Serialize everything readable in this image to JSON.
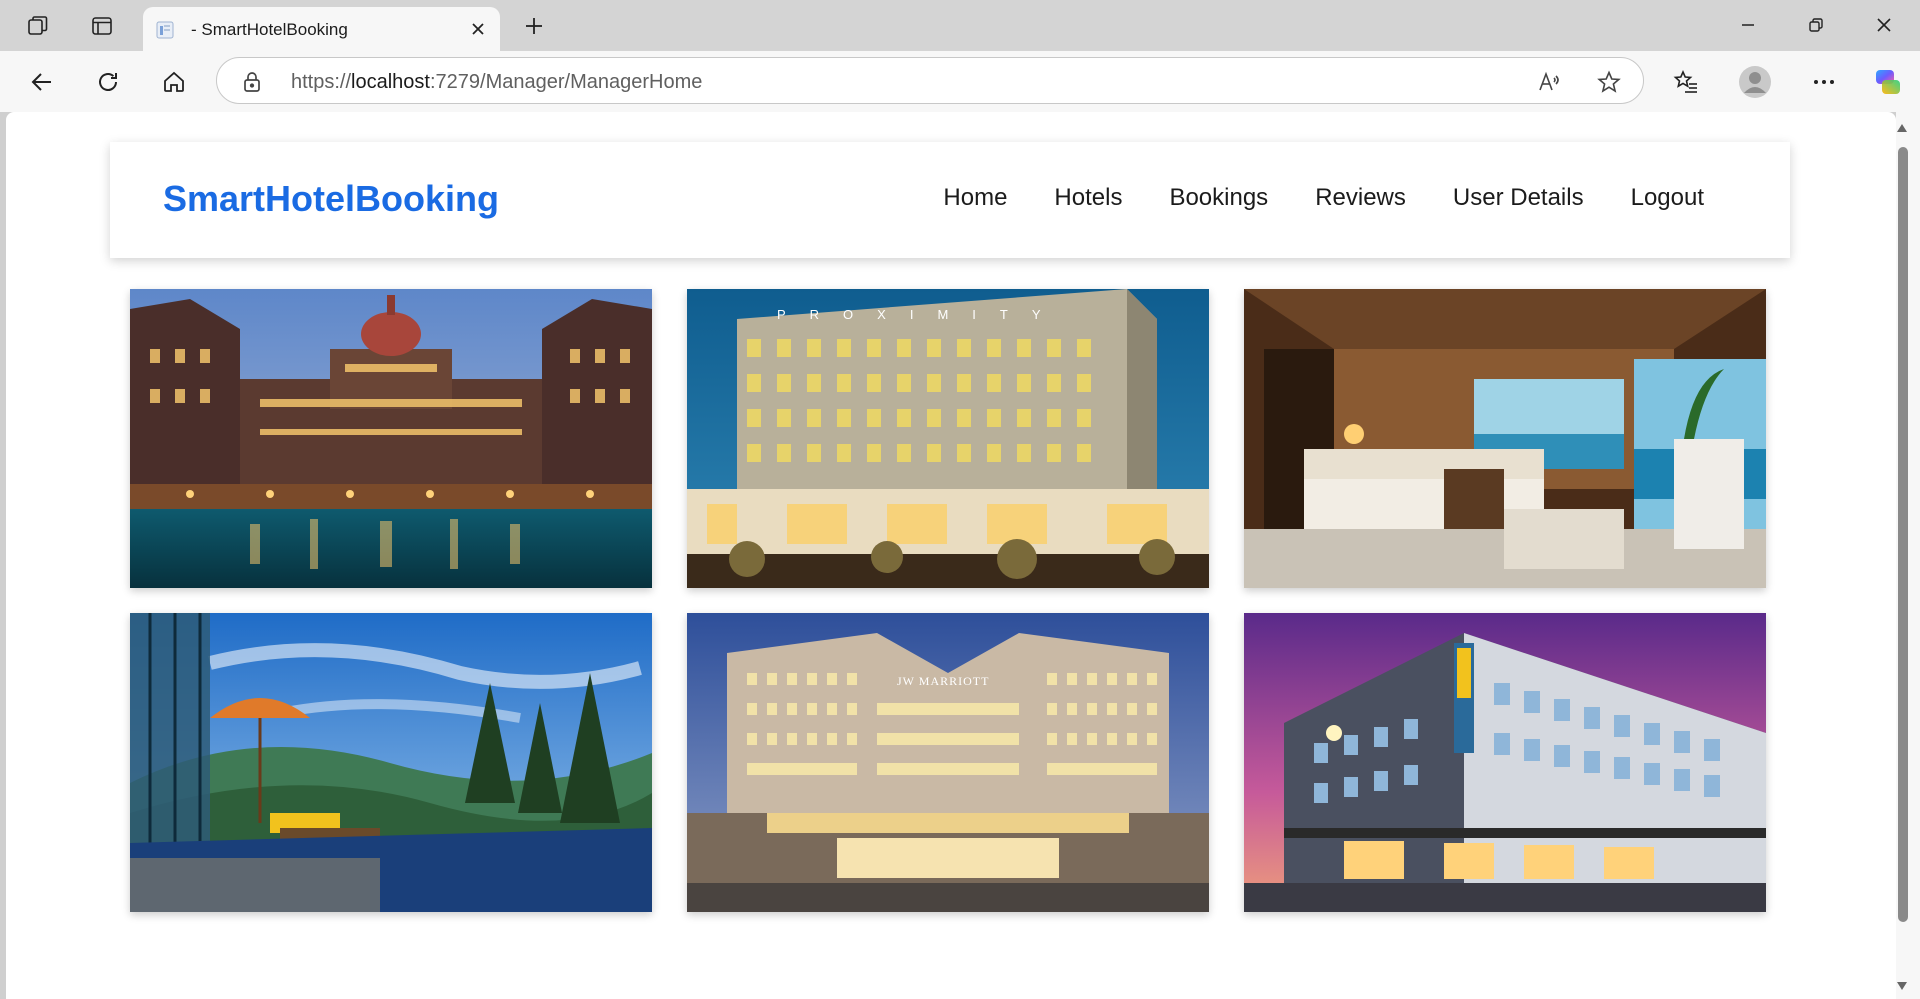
{
  "browser": {
    "tab_title": "- SmartHotelBooking",
    "url_scheme": "https://",
    "url_host": "localhost",
    "url_rest": ":7279/Manager/ManagerHome"
  },
  "site": {
    "brand": "SmartHotelBooking",
    "brand_color": "#1a6be3",
    "nav": [
      "Home",
      "Hotels",
      "Bookings",
      "Reviews",
      "User Details",
      "Logout"
    ]
  },
  "gallery": {
    "images": [
      {
        "name": "hotel-photo-palace",
        "description_icon": "palace-hotel-night-image"
      },
      {
        "name": "hotel-photo-proximity",
        "description_icon": "proximity-hotel-building-image"
      },
      {
        "name": "hotel-photo-bedroom",
        "description_icon": "luxury-bedroom-image"
      },
      {
        "name": "hotel-photo-terrace",
        "description_icon": "mountain-terrace-image"
      },
      {
        "name": "hotel-photo-jwmarriott",
        "description_icon": "jw-marriott-hotel-image"
      },
      {
        "name": "hotel-photo-modern",
        "description_icon": "modern-hotel-dusk-image"
      }
    ],
    "signage": {
      "proximity": "PROXIMITY",
      "jwmarriott": "JW MARRIOTT"
    }
  }
}
